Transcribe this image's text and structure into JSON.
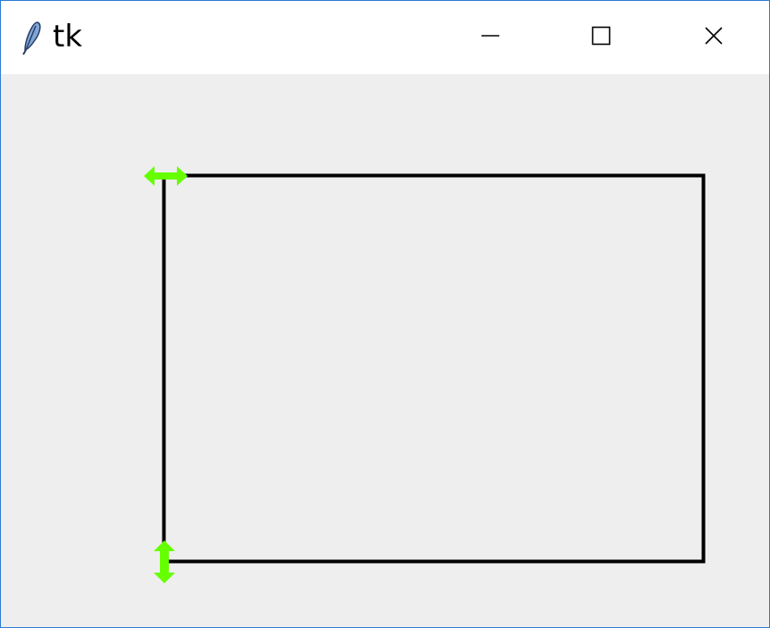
{
  "window": {
    "title": "tk",
    "app_icon": "feather-icon",
    "controls": {
      "minimize_icon": "minimize-icon",
      "maximize_icon": "maximize-icon",
      "close_icon": "close-icon"
    },
    "border_color": "#2b7bd4"
  },
  "canvas": {
    "background": "#eeeeee",
    "rectangle": {
      "stroke": "#000000"
    },
    "handles": [
      {
        "name": "horizontal-resize-handle",
        "icon": "horizontal-double-arrow-icon",
        "color": "#66ff00"
      },
      {
        "name": "vertical-resize-handle",
        "icon": "vertical-double-arrow-icon",
        "color": "#66ff00"
      }
    ]
  }
}
